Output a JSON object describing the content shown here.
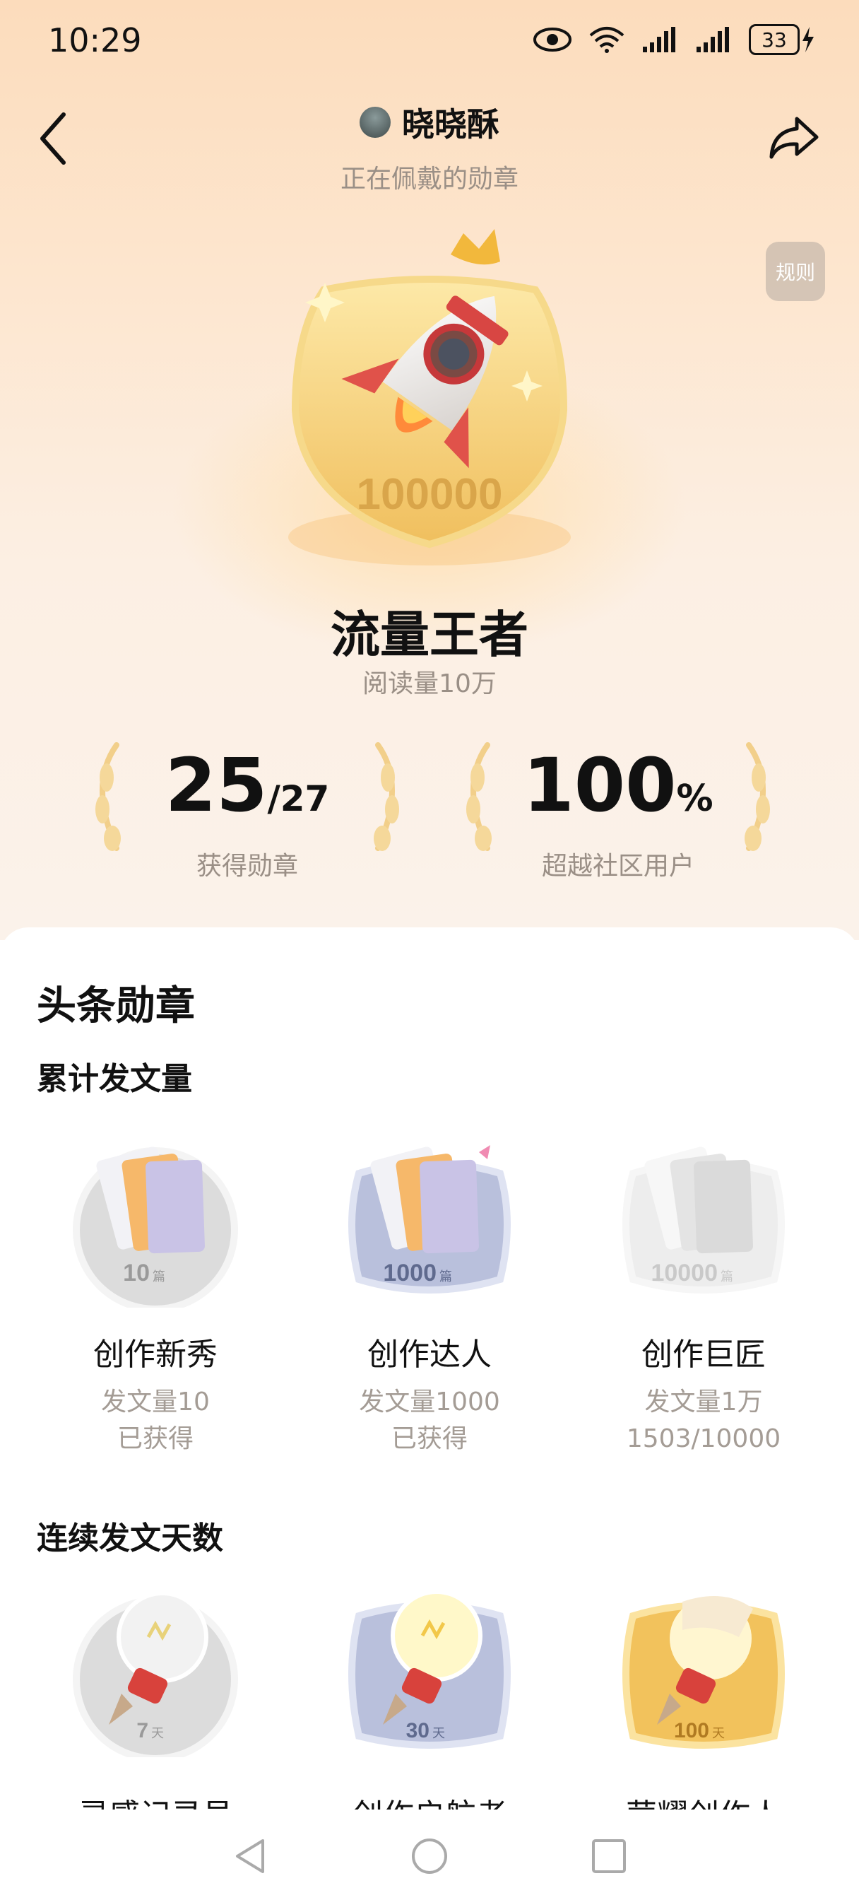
{
  "status_bar": {
    "time": "10:29",
    "battery": "33"
  },
  "header": {
    "username": "晓晓酥",
    "subtitle": "正在佩戴的勋章",
    "rules_label": "规则"
  },
  "featured_badge": {
    "number": "100000",
    "name": "流量王者",
    "description": "阅读量10万"
  },
  "stats": {
    "obtained": {
      "value": "25",
      "total": "/27",
      "label": "获得勋章"
    },
    "surpass": {
      "value": "100",
      "unit": "%",
      "label": "超越社区用户"
    }
  },
  "section": {
    "title": "头条勋章"
  },
  "groups": [
    {
      "title": "累计发文量",
      "medals": [
        {
          "name": "创作新秀",
          "desc": "发文量10",
          "status": "已获得",
          "art_number": "10",
          "art_unit": "篇",
          "tier": "silver"
        },
        {
          "name": "创作达人",
          "desc": "发文量1000",
          "status": "已获得",
          "art_number": "1000",
          "art_unit": "篇",
          "tier": "blue"
        },
        {
          "name": "创作巨匠",
          "desc": "发文量1万",
          "status": "1503/10000",
          "art_number": "10000",
          "art_unit": "篇",
          "tier": "locked"
        }
      ]
    },
    {
      "title": "连续发文天数",
      "medals": [
        {
          "name": "灵感记录员",
          "art_number": "7",
          "art_unit": "天",
          "tier": "silver"
        },
        {
          "name": "创作启航者",
          "art_number": "30",
          "art_unit": "天",
          "tier": "blue"
        },
        {
          "name": "荣耀创作人",
          "art_number": "100",
          "art_unit": "天",
          "tier": "gold"
        }
      ]
    }
  ],
  "icons": [
    "eye-icon",
    "wifi-icon",
    "signal-icon",
    "battery-icon",
    "charging-icon",
    "back-icon",
    "share-icon",
    "nav-back-icon",
    "nav-home-icon",
    "nav-recents-icon"
  ],
  "colors": {
    "accent_gold": "#f0c36a",
    "muted_text": "#9a8f86"
  }
}
